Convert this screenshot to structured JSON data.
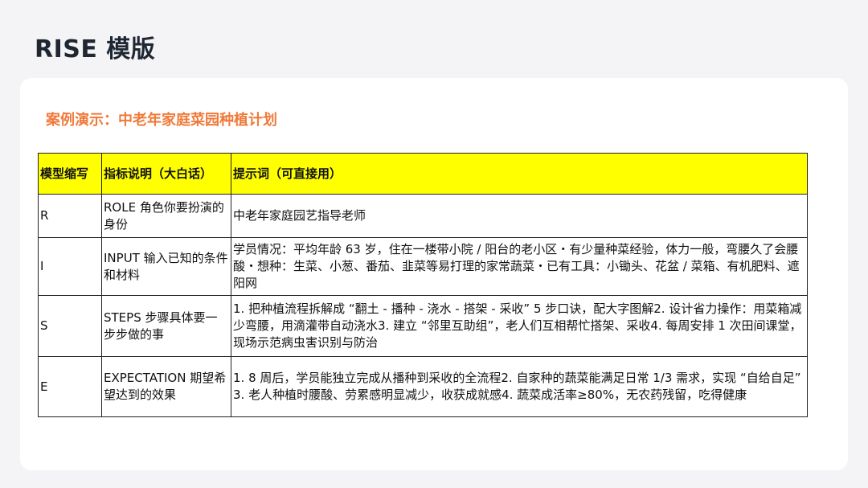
{
  "page": {
    "title": "RISE 模版"
  },
  "card": {
    "subtitle": "案例演示：中老年家庭菜园种植计划"
  },
  "table": {
    "headers": [
      "模型缩写",
      "指标说明（大白话）",
      "提示词（可直接用）"
    ],
    "header_bg": "#ffff00",
    "rows": [
      {
        "abbr": "R",
        "desc": "ROLE 角色你要扮演的身份",
        "prompt": "中老年家庭园艺指导老师"
      },
      {
        "abbr": "I",
        "desc": "INPUT 输入已知的条件和材料",
        "prompt": "学员情况：平均年龄 63 岁，住在一楼带小院 / 阳台的老小区・有少量种菜经验，体力一般，弯腰久了会腰酸・想种：生菜、小葱、番茄、韭菜等易打理的家常蔬菜・已有工具：小锄头、花盆 / 菜箱、有机肥料、遮阳网"
      },
      {
        "abbr": "S",
        "desc": "STEPS 步骤具体要一步步做的事",
        "prompt": "1. 把种植流程拆解成 “翻土 - 播种 - 浇水 - 搭架 - 采收” 5 步口诀，配大字图解2. 设计省力操作：用菜箱减少弯腰，用滴灌带自动浇水3. 建立 “邻里互助组”，老人们互相帮忙搭架、采收4. 每周安排 1 次田间课堂，现场示范病虫害识别与防治"
      },
      {
        "abbr": "E",
        "desc": "EXPECTATION 期望希望达到的效果",
        "prompt": "1. 8 周后，学员能独立完成从播种到采收的全流程2. 自家种的蔬菜能满足日常 1/3 需求，实现 “自给自足” 3. 老人种植时腰酸、劳累感明显减少，收获成就感4. 蔬菜成活率≥80%，无农药残留，吃得健康"
      }
    ]
  },
  "colors": {
    "title": "#1f2733",
    "subtitle": "#f07a3a",
    "background": "#f4f4f6",
    "card": "#ffffff"
  }
}
